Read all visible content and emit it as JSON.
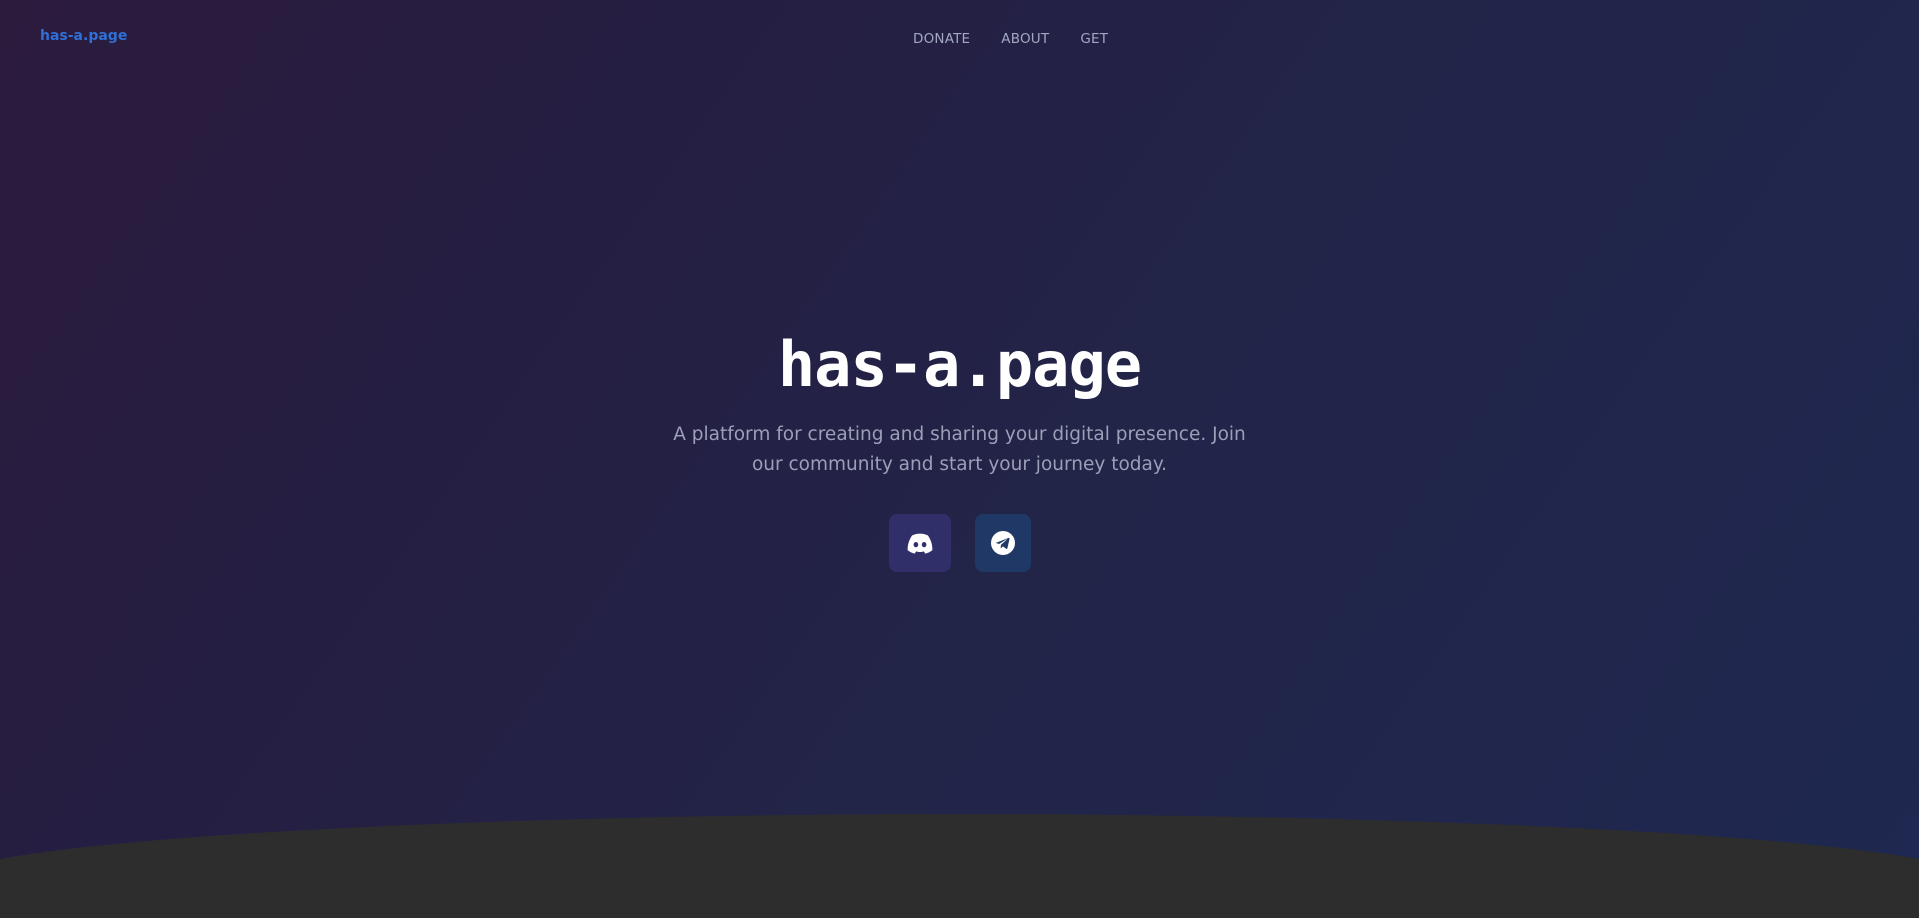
{
  "header": {
    "brand": "has-a.page",
    "nav": [
      "DONATE",
      "ABOUT",
      "GET"
    ]
  },
  "hero": {
    "title": "has-a.page",
    "subtitle": "A platform for creating and sharing your digital presence. Join our community and start your journey today."
  },
  "social": [
    {
      "name": "discord",
      "icon": "discord-icon"
    },
    {
      "name": "telegram",
      "icon": "telegram-icon"
    }
  ],
  "colors": {
    "background_start": "#2c1b3d",
    "background_end": "#1e2850",
    "brand_link": "#2f6fd6",
    "nav_text": "#a3a8c2",
    "subtitle_text": "#9b9fb8",
    "discord_button": "#312f6a",
    "telegram_button": "#1f3866",
    "bottom_section": "#2d2d2d"
  }
}
